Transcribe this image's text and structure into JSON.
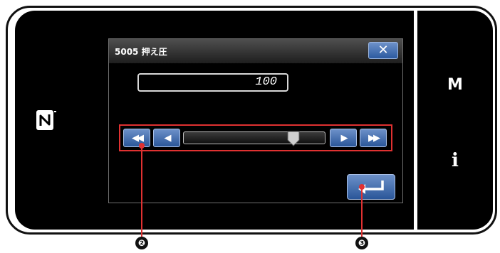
{
  "side_panel": {
    "m_label": "M",
    "info_label": "i"
  },
  "dialog": {
    "title": "5005 押え圧",
    "close_glyph": "✕",
    "value": "100"
  },
  "slider": {
    "fast_left_glyph": "◀◀",
    "left_glyph": "◀",
    "right_glyph": "▶",
    "fast_right_glyph": "▶▶",
    "level": 0.78
  },
  "callouts": {
    "slider_callout": "❷",
    "enter_callout": "❸"
  },
  "colors": {
    "button_blue": "#2a5699",
    "highlight_red": "#e03131"
  },
  "icons": [
    "nfc-icon",
    "close-icon",
    "fast-rewind-icon",
    "step-left-icon",
    "step-right-icon",
    "fast-forward-icon",
    "enter-icon"
  ]
}
